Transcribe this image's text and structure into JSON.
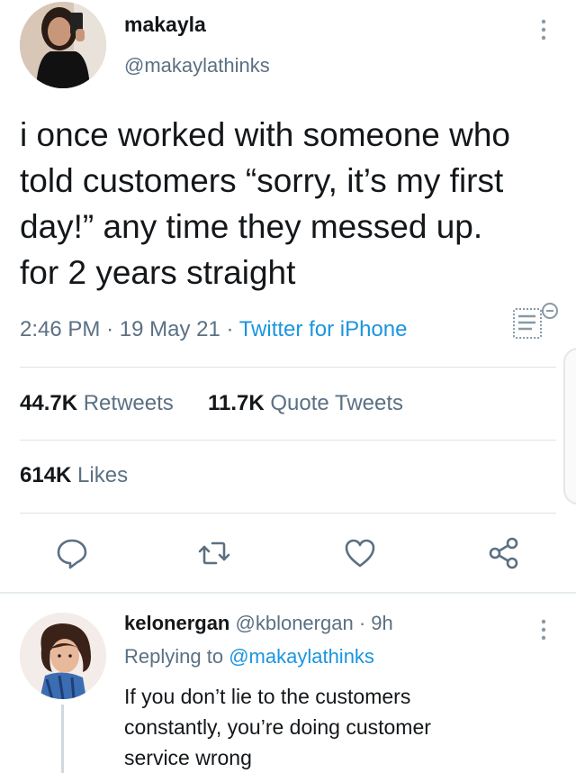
{
  "tweet": {
    "display_name": "makayla",
    "handle": "@makaylathinks",
    "text": "i once worked with someone who\ntold customers “sorry, it’s my first\nday!” any time they messed up.\nfor 2 years straight",
    "time": "2:46 PM",
    "date": "19 May 21",
    "source": "Twitter for iPhone",
    "retweets_count": "44.7K",
    "retweets_label": "Retweets",
    "quotes_count": "11.7K",
    "quotes_label": "Quote Tweets",
    "likes_count": "614K",
    "likes_label": "Likes"
  },
  "reply": {
    "display_name": "kelonergan",
    "handle": "@kblonergan",
    "age": "9h",
    "replying_prefix": "Replying to",
    "replying_to": "@makaylathinks",
    "text": "If you don’t lie to the customers\nconstantly, you’re doing customer\nservice wrong"
  },
  "icons": {
    "more": "vertical-dots-icon",
    "analytics": "analytics-icon",
    "reply": "comment-icon",
    "retweet": "retweet-icon",
    "like": "heart-icon",
    "share": "share-icon"
  },
  "colors": {
    "link": "#1b95e0",
    "secondary_text": "#5b7083",
    "primary_text": "#14171a",
    "icon": "#5b7083"
  }
}
